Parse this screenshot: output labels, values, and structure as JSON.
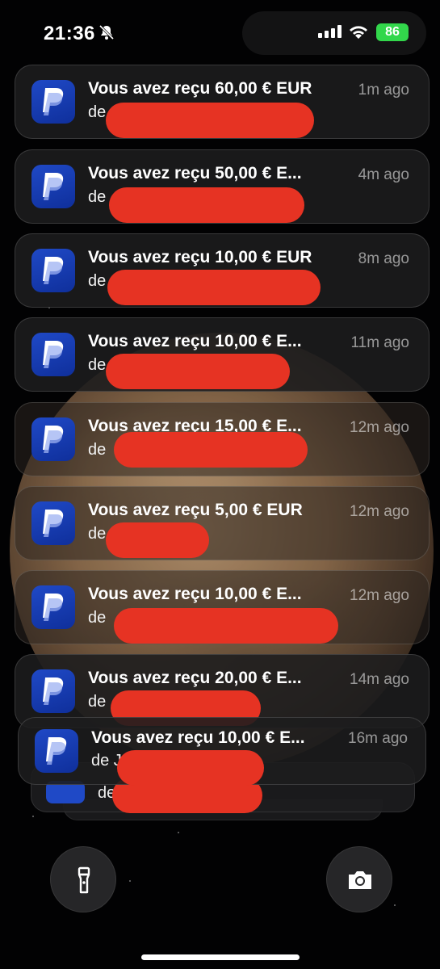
{
  "status_bar": {
    "time": "21:36",
    "battery": "86",
    "icons": [
      "bell-slash-icon",
      "cellular-signal-icon",
      "wifi-icon",
      "battery-icon"
    ]
  },
  "notifications": [
    {
      "title": "Vous avez reçu 60,00 € EUR",
      "body": "de J",
      "time": "1m ago"
    },
    {
      "title": "Vous avez reçu 50,00 € E...",
      "body": "de",
      "time": "4m ago"
    },
    {
      "title": "Vous avez reçu 10,00 € EUR",
      "body": "de",
      "time": "8m ago"
    },
    {
      "title": "Vous avez reçu 10,00 € E...",
      "body": "de",
      "time": "11m ago"
    },
    {
      "title": "Vous avez reçu 15,00 € E...",
      "body": "de",
      "time": "12m ago"
    },
    {
      "title": "Vous avez reçu 5,00 € EUR",
      "body": "de",
      "time": "12m ago"
    },
    {
      "title": "Vous avez reçu 10,00 € E...",
      "body": "de",
      "time": "12m ago"
    },
    {
      "title": "Vous avez reçu 20,00 € E...",
      "body": "de",
      "time": "14m ago"
    },
    {
      "title": "Vous avez reçu 10,00 € E...",
      "body": "de J",
      "time": "16m ago"
    }
  ],
  "stack_tail": {
    "body": "de J"
  },
  "app_icon": "paypal-icon",
  "colors": {
    "redaction": "#e63323",
    "paypal_blue": "#1f49c6",
    "battery_green": "#32d74b"
  },
  "bottom": {
    "left_button_icon": "flashlight-icon",
    "right_button_icon": "camera-icon"
  }
}
